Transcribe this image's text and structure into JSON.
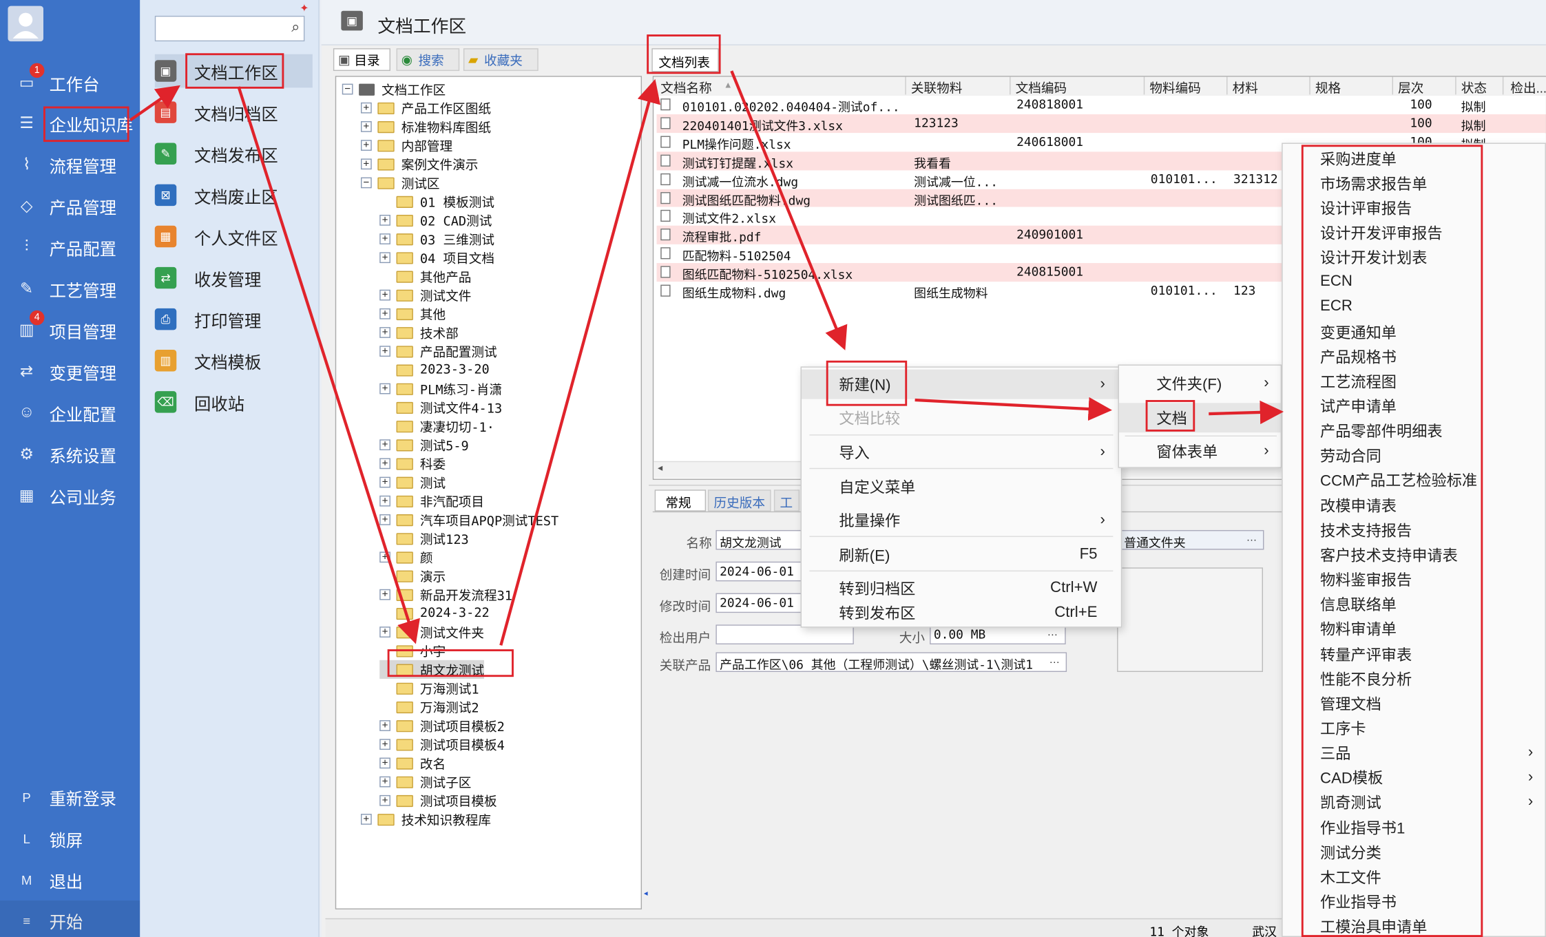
{
  "colors": {
    "nav_bg": "#3d73c8",
    "subnav_bg": "#dde8f6",
    "highlight_red": "#e0232b",
    "row_pink": "#fde0e0"
  },
  "nav": {
    "items": [
      {
        "label": "工作台",
        "icon": "monitor-icon",
        "badge": "1"
      },
      {
        "label": "企业知识库",
        "icon": "list-icon"
      },
      {
        "label": "流程管理",
        "icon": "flow-icon"
      },
      {
        "label": "产品管理",
        "icon": "cube-icon"
      },
      {
        "label": "产品配置",
        "icon": "sliders-icon"
      },
      {
        "label": "工艺管理",
        "icon": "wrench-icon"
      },
      {
        "label": "项目管理",
        "icon": "chart-icon",
        "badge": "4"
      },
      {
        "label": "变更管理",
        "icon": "swap-icon"
      },
      {
        "label": "企业配置",
        "icon": "users-icon"
      },
      {
        "label": "系统设置",
        "icon": "gear-icon"
      },
      {
        "label": "公司业务",
        "icon": "grid-icon"
      }
    ],
    "bottom": [
      {
        "key": "P",
        "label": "重新登录"
      },
      {
        "key": "L",
        "label": "锁屏"
      },
      {
        "key": "M",
        "label": "退出"
      },
      {
        "key": "≡",
        "label": "开始"
      }
    ]
  },
  "subnav": {
    "search_placeholder": "",
    "items": [
      {
        "label": "文档工作区",
        "icon": "▣",
        "color": "#666"
      },
      {
        "label": "文档归档区",
        "icon": "▤",
        "color": "#e0473c"
      },
      {
        "label": "文档发布区",
        "icon": "✎",
        "color": "#35a050"
      },
      {
        "label": "文档废止区",
        "icon": "⊠",
        "color": "#2f6fbf"
      },
      {
        "label": "个人文件区",
        "icon": "▦",
        "color": "#e8842e"
      },
      {
        "label": "收发管理",
        "icon": "⇄",
        "color": "#35a050"
      },
      {
        "label": "打印管理",
        "icon": "⎙",
        "color": "#2f6fbf"
      },
      {
        "label": "文档模板",
        "icon": "▥",
        "color": "#e8a030"
      },
      {
        "label": "回收站",
        "icon": "⌫",
        "color": "#35a050"
      }
    ]
  },
  "header": {
    "title": "文档工作区"
  },
  "left_tabs": [
    "目录",
    "搜索",
    "收藏夹"
  ],
  "tree": {
    "root": "文档工作区",
    "top": [
      "产品工作区图纸",
      "标准物料库图纸",
      "内部管理",
      "案例文件演示",
      "测试区"
    ],
    "children": [
      "01 模板测试",
      "02 CAD测试",
      "03 三维测试",
      "04 项目文档",
      "其他产品",
      "测试文件",
      "其他",
      "技术部",
      "产品配置测试",
      "2023-3-20",
      "PLM练习-肖潇",
      "测试文件4-13",
      "凄凄切切-1·",
      "测试5-9",
      "科委",
      "测试",
      "非汽配项目",
      "汽车项目APQP测试TEST",
      "测试123",
      "颜",
      "演示",
      "新品开发流程31",
      "2024-3-22",
      "测试文件夹",
      "小宇",
      "胡文龙测试",
      "万海测试1",
      "万海测试2",
      "测试项目模板2",
      "测试项目模板4",
      "改名",
      "测试子区",
      "测试项目模板"
    ],
    "last": "技术知识教程库"
  },
  "doc_list": {
    "tab": "文档列表",
    "columns": [
      "文档名称",
      "关联物料",
      "文档编码",
      "物料编码",
      "材料",
      "规格",
      "层次",
      "状态",
      "检出..."
    ],
    "rows": [
      [
        "010101.020202.040404-测试of...",
        "",
        "240818001",
        "",
        "",
        "",
        "100",
        "拟制"
      ],
      [
        "220401401测试文件3.xlsx",
        "123123",
        "",
        "",
        "",
        "",
        "100",
        "拟制"
      ],
      [
        "PLM操作问题.xlsx",
        "",
        "240618001",
        "",
        "",
        "",
        "100",
        "拟制"
      ],
      [
        "测试钉钉提醒.xlsx",
        "我看看",
        "",
        "",
        "",
        "",
        "",
        ""
      ],
      [
        "测试减一位流水.dwg",
        "测试减一位...",
        "",
        "010101...",
        "321312",
        "",
        "",
        ""
      ],
      [
        "测试图纸匹配物料.dwg",
        "测试图纸匹...",
        "",
        "",
        "",
        "",
        "",
        ""
      ],
      [
        "测试文件2.xlsx",
        "",
        "",
        "",
        "",
        "",
        "",
        ""
      ],
      [
        "流程审批.pdf",
        "",
        "240901001",
        "",
        "",
        "",
        "",
        ""
      ],
      [
        "匹配物料-5102504",
        "",
        "",
        "",
        "",
        "",
        "",
        ""
      ],
      [
        "图纸匹配物料-5102504.xlsx",
        "",
        "240815001",
        "",
        "",
        "",
        "",
        ""
      ],
      [
        "图纸生成物料.dwg",
        "图纸生成物料",
        "",
        "010101...",
        "123",
        "",
        "",
        ""
      ]
    ]
  },
  "detail": {
    "tabs": [
      "常规",
      "历史版本",
      "工"
    ],
    "name_label": "名称",
    "name_value": "胡文龙测试",
    "created_label": "创建时间",
    "created_value": "2024-06-01",
    "modified_label": "修改时间",
    "modified_value": "2024-06-01",
    "checkout_label": "检出用户",
    "checkout_value": "",
    "size_label": "大小",
    "size_value": "0.00 MB",
    "type_value": "普通文件夹",
    "product_label": "关联产品",
    "product_value": "产品工作区\\06 其他（工程师测试）\\螺丝测试-1\\测试1"
  },
  "status_bar": {
    "count": "11 个对象",
    "location": "武汉"
  },
  "context_menu": [
    {
      "label": "新建(N)",
      "arrow": "›"
    },
    {
      "label": "文档比较",
      "disabled": true
    },
    {
      "label": "导入",
      "arrow": "›"
    },
    {
      "label": "自定义菜单"
    },
    {
      "label": "批量操作",
      "arrow": "›"
    },
    {
      "label": "刷新(E)",
      "shortcut": "F5"
    },
    {
      "label": "转到归档区",
      "shortcut": "Ctrl+W"
    },
    {
      "label": "转到发布区",
      "shortcut": "Ctrl+E"
    }
  ],
  "submenu": [
    {
      "label": "文件夹(F)",
      "arrow": "›"
    },
    {
      "label": "文档"
    },
    {
      "label": "窗体表单",
      "arrow": "›"
    }
  ],
  "doc_types": [
    {
      "label": "采购进度单"
    },
    {
      "label": "市场需求报告单"
    },
    {
      "label": "设计评审报告"
    },
    {
      "label": "设计开发评审报告"
    },
    {
      "label": "设计开发计划表"
    },
    {
      "label": "ECN"
    },
    {
      "label": "ECR"
    },
    {
      "label": "变更通知单"
    },
    {
      "label": "产品规格书"
    },
    {
      "label": "工艺流程图"
    },
    {
      "label": "试产申请单"
    },
    {
      "label": "产品零部件明细表"
    },
    {
      "label": "劳动合同"
    },
    {
      "label": "CCM产品工艺检验标准"
    },
    {
      "label": "改模申请表"
    },
    {
      "label": "技术支持报告"
    },
    {
      "label": "客户技术支持申请表"
    },
    {
      "label": "物料鉴审报告"
    },
    {
      "label": "信息联络单"
    },
    {
      "label": "物料审请单"
    },
    {
      "label": "转量产评审表"
    },
    {
      "label": "性能不良分析"
    },
    {
      "label": "管理文档"
    },
    {
      "label": "工序卡"
    },
    {
      "label": "三品",
      "arrow": "›"
    },
    {
      "label": "CAD模板",
      "arrow": "›"
    },
    {
      "label": "凯奇测试",
      "arrow": "›"
    },
    {
      "label": "作业指导书1"
    },
    {
      "label": "测试分类"
    },
    {
      "label": "木工文件"
    },
    {
      "label": "作业指导书"
    },
    {
      "label": "工模治具申请单"
    }
  ]
}
